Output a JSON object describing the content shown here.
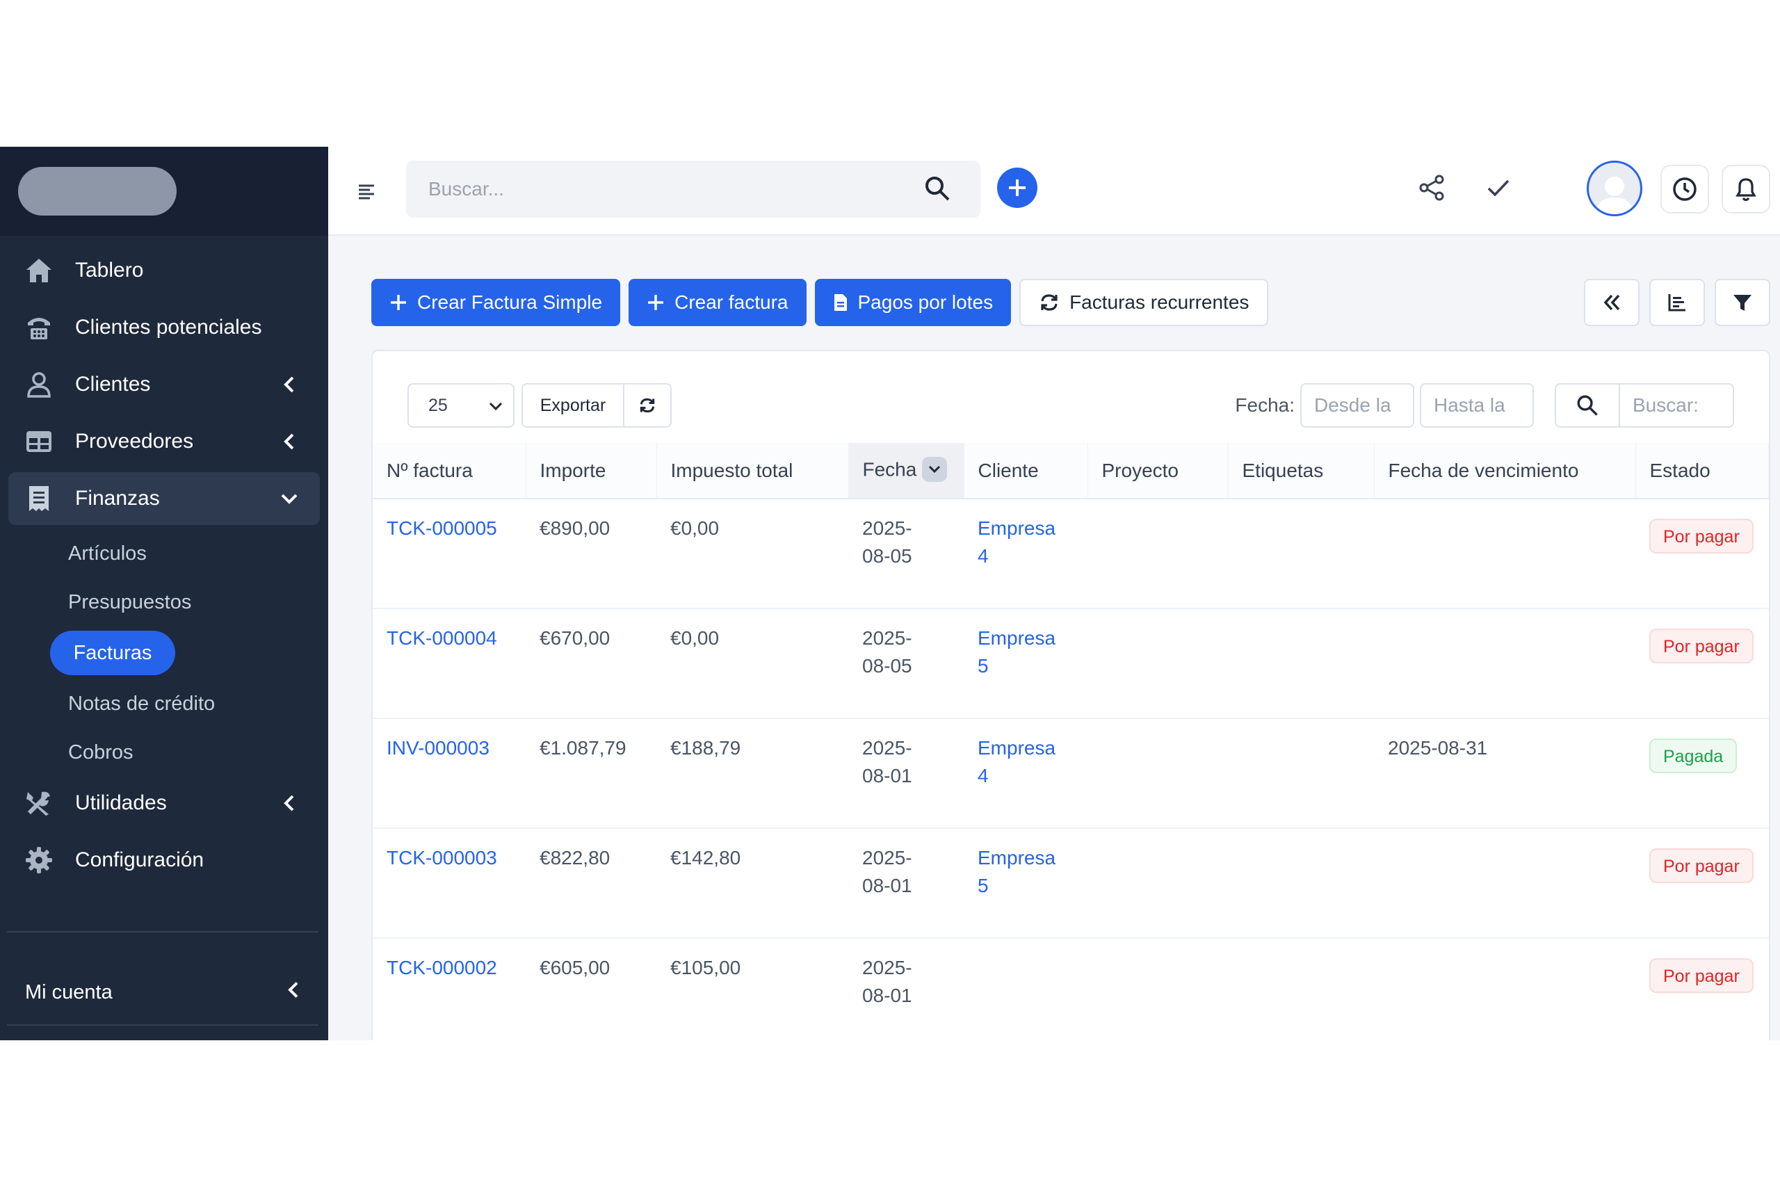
{
  "sidebar": {
    "items": [
      {
        "label": "Tablero",
        "icon": "home-icon"
      },
      {
        "label": "Clientes potenciales",
        "icon": "leads-icon"
      },
      {
        "label": "Clientes",
        "icon": "user-icon"
      },
      {
        "label": "Proveedores",
        "icon": "table-icon"
      },
      {
        "label": "Finanzas",
        "icon": "receipt-icon"
      },
      {
        "label": "Utilidades",
        "icon": "tools-icon"
      },
      {
        "label": "Configuración",
        "icon": "gear-icon"
      }
    ],
    "finance_sub": [
      "Artículos",
      "Presupuestos",
      "Facturas",
      "Notas de crédito",
      "Cobros"
    ],
    "account_label": "Mi cuenta"
  },
  "topbar": {
    "search_placeholder": "Buscar..."
  },
  "actions": {
    "simple_invoice": "Crear Factura Simple",
    "create_invoice": "Crear factura",
    "batch_payments": "Pagos por lotes",
    "recurring": "Facturas recurrentes"
  },
  "toolbar": {
    "page_size": "25",
    "export": "Exportar",
    "date_label": "Fecha:",
    "date_from_placeholder": "Desde la",
    "date_to_placeholder": "Hasta la",
    "search_placeholder": "Buscar:"
  },
  "table": {
    "columns": [
      "Nº factura",
      "Importe",
      "Impuesto total",
      "Fecha",
      "Cliente",
      "Proyecto",
      "Etiquetas",
      "Fecha de vencimiento",
      "Estado"
    ],
    "rows": [
      {
        "number": "TCK-000005",
        "amount": "€890,00",
        "tax": "€0,00",
        "date1": "2025-",
        "date2": "08-05",
        "client1": "Empresa",
        "client2": "4",
        "project": "",
        "tags": "",
        "due": "",
        "status": "Por pagar",
        "status_type": "unpaid"
      },
      {
        "number": "TCK-000004",
        "amount": "€670,00",
        "tax": "€0,00",
        "date1": "2025-",
        "date2": "08-05",
        "client1": "Empresa",
        "client2": "5",
        "project": "",
        "tags": "",
        "due": "",
        "status": "Por pagar",
        "status_type": "unpaid"
      },
      {
        "number": "INV-000003",
        "amount": "€1.087,79",
        "tax": "€188,79",
        "date1": "2025-",
        "date2": "08-01",
        "client1": "Empresa",
        "client2": "4",
        "project": "",
        "tags": "",
        "due": "2025-08-31",
        "status": "Pagada",
        "status_type": "paid"
      },
      {
        "number": "TCK-000003",
        "amount": "€822,80",
        "tax": "€142,80",
        "date1": "2025-",
        "date2": "08-01",
        "client1": "Empresa",
        "client2": "5",
        "project": "",
        "tags": "",
        "due": "",
        "status": "Por pagar",
        "status_type": "unpaid"
      },
      {
        "number": "TCK-000002",
        "amount": "€605,00",
        "tax": "€105,00",
        "date1": "2025-",
        "date2": "08-01",
        "client1": "",
        "client2": "",
        "project": "",
        "tags": "",
        "due": "",
        "status": "Por pagar",
        "status_type": "unpaid"
      }
    ]
  },
  "colors": {
    "accent": "#2563eb",
    "sidebar": "#1e293b",
    "unpaid": "#dc2626",
    "paid": "#16a34a"
  }
}
